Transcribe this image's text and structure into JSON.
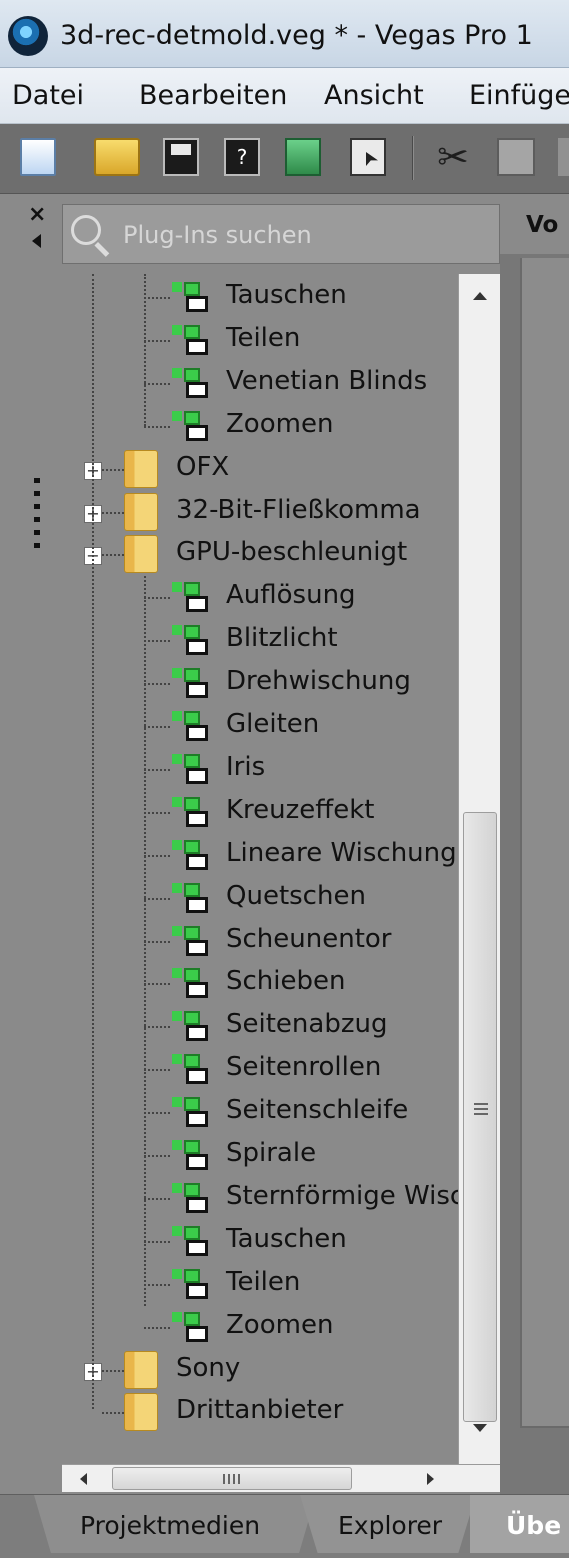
{
  "window": {
    "title": "3d-rec-detmold.veg * - Vegas Pro 1"
  },
  "menu": {
    "items": [
      "Datei",
      "Bearbeiten",
      "Ansicht",
      "Einfüge"
    ]
  },
  "toolbar": {
    "icons": [
      "new-file-icon",
      "open-folder-icon",
      "save-icon",
      "save-as-icon",
      "render-icon",
      "properties-icon",
      "cut-icon",
      "copy-icon",
      "paste-icon"
    ]
  },
  "search": {
    "placeholder": "Plug-Ins suchen",
    "value": ""
  },
  "tree": {
    "items": [
      {
        "label": "Tauschen",
        "type": "plugin",
        "level": 2
      },
      {
        "label": "Teilen",
        "type": "plugin",
        "level": 2
      },
      {
        "label": "Venetian Blinds",
        "type": "plugin",
        "level": 2
      },
      {
        "label": "Zoomen",
        "type": "plugin",
        "level": 2
      },
      {
        "label": "OFX",
        "type": "folder",
        "level": 1,
        "toggle": "+"
      },
      {
        "label": "32-Bit-Fließkomma",
        "type": "folder",
        "level": 1,
        "toggle": "+"
      },
      {
        "label": "GPU-beschleunigt",
        "type": "folder",
        "level": 1,
        "toggle": "−"
      },
      {
        "label": "Auflösung",
        "type": "plugin",
        "level": 2
      },
      {
        "label": "Blitzlicht",
        "type": "plugin",
        "level": 2
      },
      {
        "label": "Drehwischung",
        "type": "plugin",
        "level": 2
      },
      {
        "label": "Gleiten",
        "type": "plugin",
        "level": 2
      },
      {
        "label": "Iris",
        "type": "plugin",
        "level": 2
      },
      {
        "label": "Kreuzeffekt",
        "type": "plugin",
        "level": 2
      },
      {
        "label": "Lineare Wischung",
        "type": "plugin",
        "level": 2
      },
      {
        "label": "Quetschen",
        "type": "plugin",
        "level": 2
      },
      {
        "label": "Scheunentor",
        "type": "plugin",
        "level": 2
      },
      {
        "label": "Schieben",
        "type": "plugin",
        "level": 2
      },
      {
        "label": "Seitenabzug",
        "type": "plugin",
        "level": 2
      },
      {
        "label": "Seitenrollen",
        "type": "plugin",
        "level": 2
      },
      {
        "label": "Seitenschleife",
        "type": "plugin",
        "level": 2
      },
      {
        "label": "Spirale",
        "type": "plugin",
        "level": 2
      },
      {
        "label": "Sternförmige Wisc",
        "type": "plugin",
        "level": 2
      },
      {
        "label": "Tauschen",
        "type": "plugin",
        "level": 2
      },
      {
        "label": "Teilen",
        "type": "plugin",
        "level": 2
      },
      {
        "label": "Zoomen",
        "type": "plugin",
        "level": 2
      },
      {
        "label": "Sony",
        "type": "folder",
        "level": 1,
        "toggle": "+"
      },
      {
        "label": "Drittanbieter",
        "type": "folder",
        "level": 1
      }
    ]
  },
  "right_pane": {
    "heading": "Vo"
  },
  "tabs": [
    {
      "label": "Projektmedien"
    },
    {
      "label": "Explorer"
    },
    {
      "label": "Übe"
    }
  ]
}
